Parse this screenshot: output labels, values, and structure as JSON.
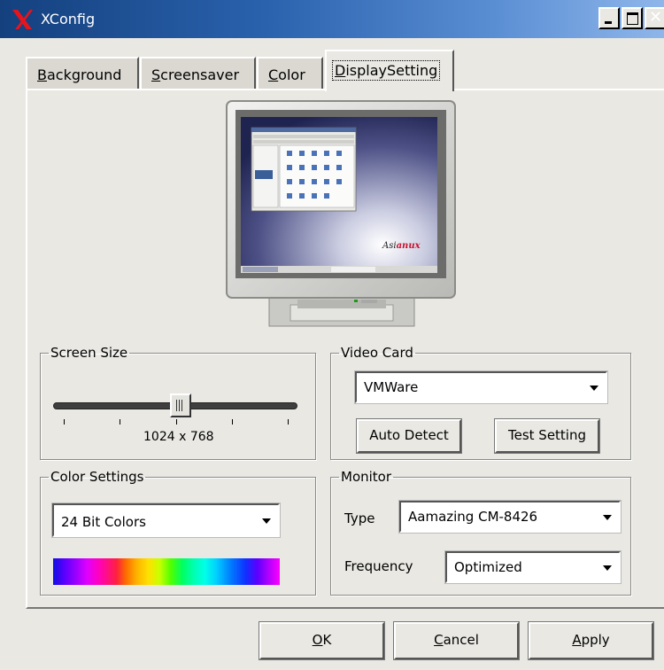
{
  "window": {
    "title": "XConfig",
    "icon": "x-logo-icon"
  },
  "tabs": [
    {
      "label": "Background",
      "accel": "B",
      "rest": "ackground"
    },
    {
      "label": "Screensaver",
      "accel": "S",
      "rest": "creensaver"
    },
    {
      "label": "Color",
      "accel": "C",
      "rest": "olor"
    },
    {
      "label": "DisplaySetting",
      "accel": "D",
      "rest": "isplaySetting",
      "active": true
    }
  ],
  "preview": {
    "brand_text": "Asianux"
  },
  "screen_size": {
    "legend": "Screen Size",
    "resolution_label": "1024 x 768",
    "slider_level": 0.52
  },
  "video_card": {
    "legend": "Video Card",
    "selected": "VMWare",
    "auto_detect_label": "Auto Detect",
    "test_setting_label": "Test Setting"
  },
  "color_settings": {
    "legend": "Color Settings",
    "selected": "24 Bit Colors"
  },
  "monitor": {
    "legend": "Monitor",
    "type_label": "Type",
    "type_selected": "Aamazing CM-8426",
    "frequency_label": "Frequency",
    "frequency_selected": "Optimized"
  },
  "footer": {
    "ok": {
      "accel": "O",
      "rest": "K"
    },
    "cancel": {
      "accel": "C",
      "rest": "ancel"
    },
    "apply": {
      "accel": "A",
      "rest": "pply"
    }
  },
  "colors": {
    "titlebar": "#2a62ad",
    "background": "#e9e8e3"
  }
}
